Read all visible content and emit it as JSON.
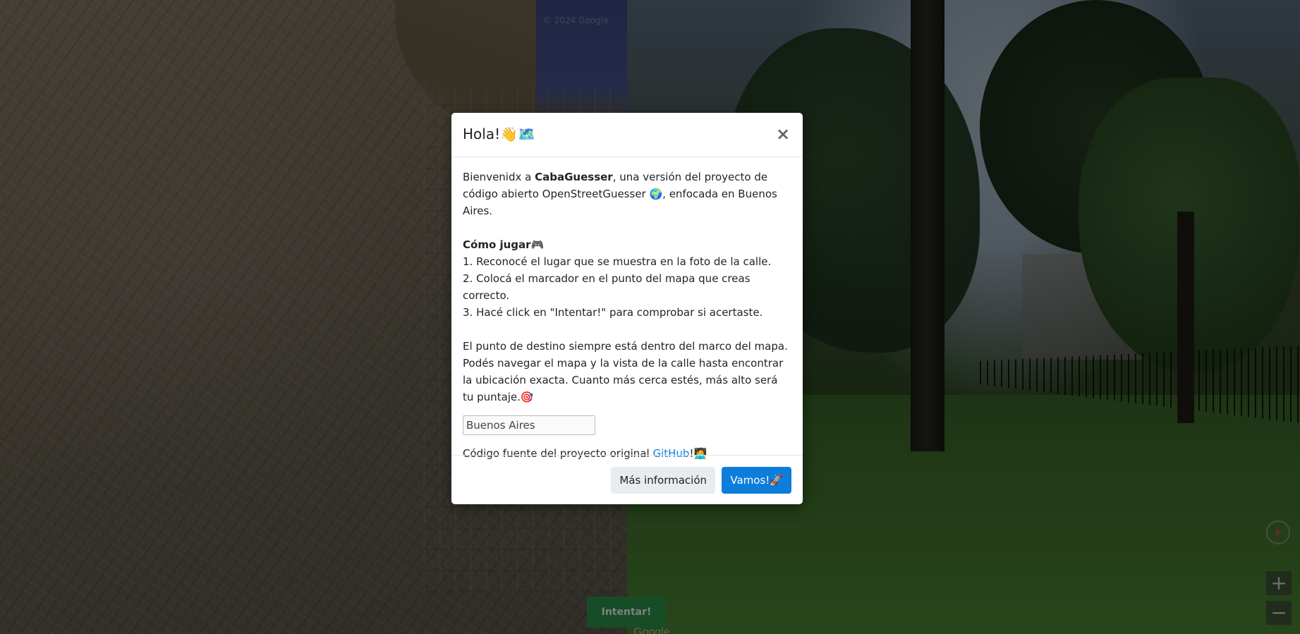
{
  "map": {
    "copyright": "© 2024 Google",
    "brand": "Google"
  },
  "controls": {
    "compass_icon": "compass-icon",
    "zoom_in": "+",
    "zoom_out": "−",
    "guess_label": "Intentar!"
  },
  "modal": {
    "title": "Hola!👋🗺️",
    "close_label": "×",
    "intro_prefix": "Bienvenidx a ",
    "intro_brand": "CabaGuesser",
    "intro_suffix": ", una versión del proyecto de código abierto OpenStreetGuesser 🌍, enfocada en Buenos Aires.",
    "howto_title": "Cómo jugar🎮",
    "steps": [
      "1. Reconocé el lugar que se muestra en la foto de la calle.",
      "2. Colocá el marcador en el punto del mapa que creas correcto.",
      "3. Hacé click en \"Intentar!\" para comprobar si acertaste."
    ],
    "info": "El punto de destino siempre está dentro del marco del mapa. Podés navegar el mapa y la vista de la calle hasta encontrar la ubicación exacta. Cuanto más cerca estés, más alto será tu puntaje.🎯",
    "region_selected": "Buenos Aires",
    "source_prefix": "Código fuente del proyecto original ",
    "source_link": "GitHub",
    "source_suffix": "!🧑‍💻",
    "more_info_label": "Más información",
    "go_label": "Vamos!🚀"
  },
  "colors": {
    "primary": "#0d7ddb",
    "secondary": "#e9ecef",
    "guess": "#2f9a4d"
  }
}
